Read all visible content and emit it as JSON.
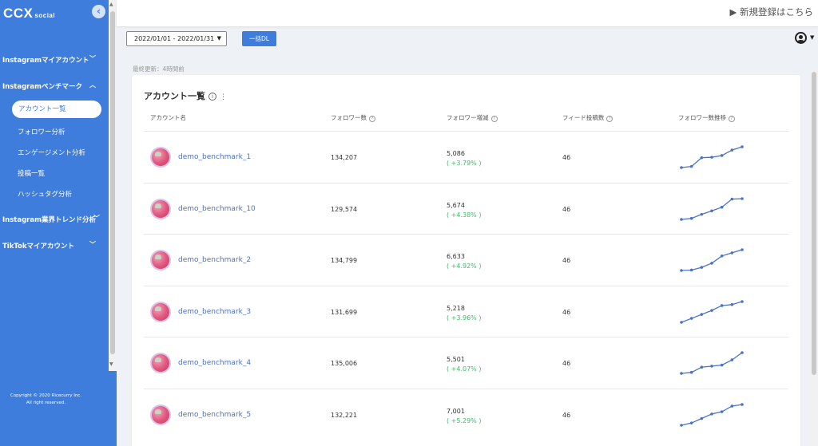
{
  "sidebar": {
    "logo_main": "CCX",
    "logo_sub": "social",
    "sections": [
      {
        "label": "Instagramマイアカウント",
        "expanded": false
      },
      {
        "label": "Instagramベンチマーク",
        "expanded": true
      },
      {
        "label": "Instagram業界トレンド分析",
        "expanded": false
      },
      {
        "label": "TikTokマイアカウント",
        "expanded": false
      }
    ],
    "items": [
      {
        "label": "アカウント一覧",
        "active": true
      },
      {
        "label": "フォロワー分析",
        "active": false
      },
      {
        "label": "エンゲージメント分析",
        "active": false
      },
      {
        "label": "投稿一覧",
        "active": false
      },
      {
        "label": "ハッシュタグ分析",
        "active": false
      }
    ],
    "copyright_line1": "Copyright © 2020 Ricecurry Inc.",
    "copyright_line2": "All right reserved."
  },
  "header": {
    "register_link": "▶ 新規登録はこちら"
  },
  "toolbar": {
    "date_range": "2022/01/01 - 2022/01/31",
    "download_label": "一括DL"
  },
  "last_updated": "最終更新：4時間前",
  "card": {
    "title": "アカウント一覧",
    "columns": [
      "アカウント名",
      "フォロワー数",
      "フォロワー増減",
      "フィード投稿数",
      "フォロワー数推移"
    ],
    "rows": [
      {
        "name": "demo_benchmark_1",
        "followers": "134,207",
        "change": "5,086",
        "change_pct": "( +3.79% )",
        "posts": "46",
        "trend": [
          0.05,
          0.1,
          0.5,
          0.52,
          0.6,
          0.85,
          1.0
        ]
      },
      {
        "name": "demo_benchmark_10",
        "followers": "129,574",
        "change": "5,674",
        "change_pct": "( +4.38% )",
        "posts": "46",
        "trend": [
          0.0,
          0.05,
          0.25,
          0.42,
          0.6,
          1.0,
          1.02
        ]
      },
      {
        "name": "demo_benchmark_2",
        "followers": "134,799",
        "change": "6,633",
        "change_pct": "( +4.92% )",
        "posts": "46",
        "trend": [
          0.0,
          0.02,
          0.15,
          0.35,
          0.7,
          0.85,
          1.0
        ]
      },
      {
        "name": "demo_benchmark_3",
        "followers": "131,699",
        "change": "5,218",
        "change_pct": "( +3.96% )",
        "posts": "46",
        "trend": [
          0.0,
          0.2,
          0.4,
          0.6,
          0.85,
          0.9,
          1.05
        ]
      },
      {
        "name": "demo_benchmark_4",
        "followers": "135,006",
        "change": "5,501",
        "change_pct": "( +4.07% )",
        "posts": "46",
        "trend": [
          0.0,
          0.05,
          0.3,
          0.35,
          0.4,
          0.65,
          1.0
        ]
      },
      {
        "name": "demo_benchmark_5",
        "followers": "132,221",
        "change": "7,001",
        "change_pct": "( +5.29% )",
        "posts": "46",
        "trend": [
          0.0,
          0.1,
          0.3,
          0.5,
          0.6,
          0.85,
          0.92
        ]
      }
    ]
  },
  "colors": {
    "primary": "#3f7ddc",
    "positive": "#3fb86b",
    "sparkline": "#4a72c6"
  }
}
